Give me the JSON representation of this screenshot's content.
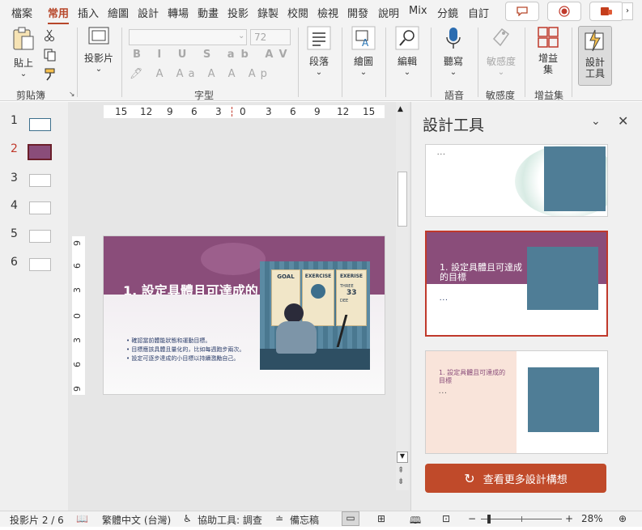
{
  "tabs": [
    "檔案",
    "常用",
    "插入",
    "繪圖",
    "設計",
    "轉場",
    "動畫",
    "投影",
    "錄製",
    "校閱",
    "檢視",
    "開發",
    "說明",
    "Mix",
    "分鏡",
    "自訂"
  ],
  "active_tab": "常用",
  "ribbon": {
    "clipboard": {
      "paste": "貼上",
      "group": "剪貼簿"
    },
    "slides": {
      "label": "投影片"
    },
    "font": {
      "size": "72",
      "group": "字型"
    },
    "paragraph": {
      "label": "段落"
    },
    "drawing": {
      "label": "繪圖"
    },
    "editing": {
      "label": "編輯"
    },
    "voice": {
      "label": "聽寫",
      "group": "語音"
    },
    "sensitivity": {
      "label": "敏感度",
      "group": "敏感度"
    },
    "addins": {
      "label": "增益集",
      "group": "增益集"
    },
    "designer": {
      "label": "設計工具"
    }
  },
  "thumbnails": [
    "1",
    "2",
    "3",
    "4",
    "5",
    "6"
  ],
  "selected_slide": "2",
  "ruler_h": [
    "15",
    "12",
    "9",
    "6",
    "3",
    "0",
    "3",
    "6",
    "9",
    "12",
    "15"
  ],
  "ruler_v": [
    "9",
    "6",
    "3",
    "0",
    "3",
    "6",
    "9"
  ],
  "slide": {
    "title": "1. 設定具體且可達成的目標",
    "bullets": [
      "確認當前體能狀態和運動目標。",
      "目標應該具體且量化的，比如每週跑步兩次。",
      "設定可逐步達成的小目標以持續激勵自己。"
    ],
    "poster_words": [
      "GOAL",
      "EXERCISE",
      "EXERISE"
    ],
    "poster_numbers": [
      "THREE",
      "33",
      "DEE"
    ]
  },
  "design_pane": {
    "title": "設計工具",
    "card2_title": "1. 設定具體且可達成的目標",
    "card3_title": "1. 設定具體且可達成的目標",
    "more_button": "查看更多設計構想"
  },
  "status": {
    "slide_info": "投影片 2 / 6",
    "language": "繁體中文 (台灣)",
    "accessibility": "協助工具: 調查",
    "notes": "備忘稿",
    "zoom": "28%"
  },
  "colors": {
    "accent": "#b7472a",
    "banner": "#8a4d7a",
    "button": "#c04a2a"
  }
}
